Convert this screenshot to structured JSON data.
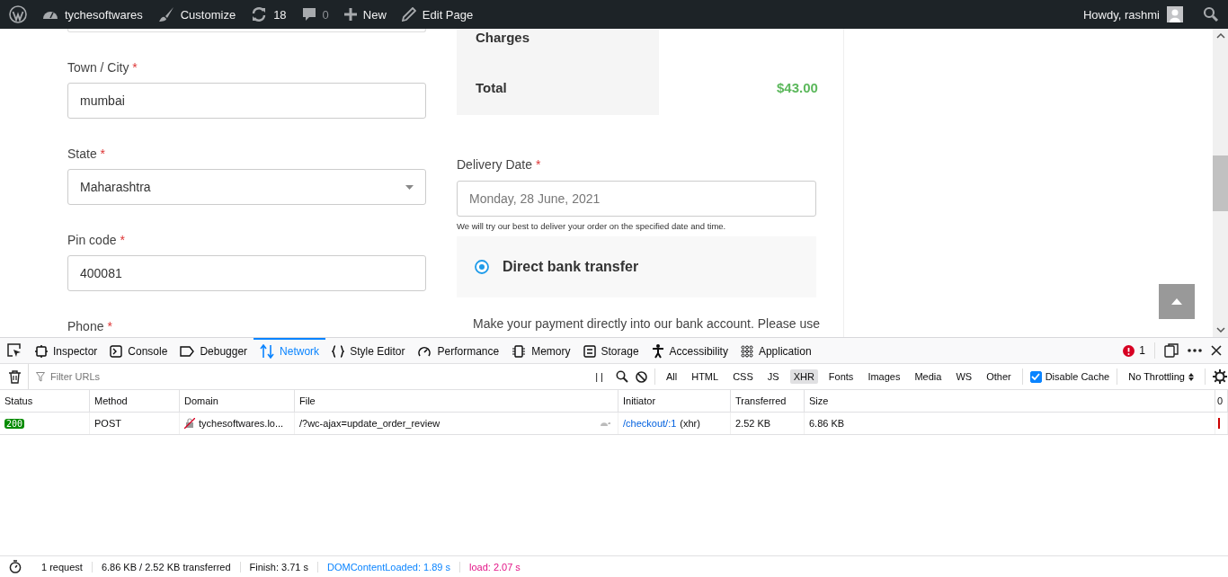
{
  "admin_bar": {
    "items": [
      {
        "kind": "wp-logo"
      },
      {
        "kind": "dashboard",
        "label": "tychesoftwares"
      },
      {
        "kind": "brush",
        "label": "Customize"
      },
      {
        "kind": "updates",
        "label": "18"
      },
      {
        "kind": "comments",
        "label": "0"
      },
      {
        "kind": "plus",
        "label": "New"
      },
      {
        "kind": "pencil",
        "label": "Edit Page"
      }
    ],
    "greeting": "Howdy, rashmi"
  },
  "billing_fields": [
    {
      "label": "Town / City",
      "required_mark": "*",
      "kind": "text",
      "value": "mumbai"
    },
    {
      "label": "State",
      "required_mark": "*",
      "kind": "select",
      "value": "Maharashtra"
    },
    {
      "label": "Pin code",
      "required_mark": "*",
      "kind": "text",
      "value": "400081"
    },
    {
      "label": "Phone",
      "required_mark": "*",
      "kind": "cut"
    }
  ],
  "order_summary": {
    "rows": [
      {
        "label": "Charges",
        "value": ""
      },
      {
        "label": "Total",
        "value": "$43.00"
      }
    ]
  },
  "delivery_date": {
    "label": "Delivery Date",
    "required_mark": "*",
    "placeholder": "Monday, 28 June, 2021",
    "hint": "We will try our best to deliver your order on the specified date and time."
  },
  "payment": {
    "method": "Direct bank transfer",
    "selected": true,
    "description": "Make your payment directly into our bank account. Please use"
  },
  "devtools": {
    "tabs": [
      {
        "kind": "inspector",
        "label": "Inspector",
        "selected": false
      },
      {
        "kind": "console",
        "label": "Console",
        "selected": false
      },
      {
        "kind": "debugger",
        "label": "Debugger",
        "selected": false
      },
      {
        "kind": "network",
        "label": "Network",
        "selected": true
      },
      {
        "kind": "style",
        "label": "Style Editor",
        "selected": false
      },
      {
        "kind": "performance",
        "label": "Performance",
        "selected": false
      },
      {
        "kind": "memory",
        "label": "Memory",
        "selected": false
      },
      {
        "kind": "storage",
        "label": "Storage",
        "selected": false
      },
      {
        "kind": "accessibility",
        "label": "Accessibility",
        "selected": false
      },
      {
        "kind": "application",
        "label": "Application",
        "selected": false
      }
    ],
    "error_count": "1",
    "filter_placeholder": "Filter URLs",
    "pause_label": "| |",
    "type_filters": [
      {
        "label": "All",
        "selected": false
      },
      {
        "label": "HTML",
        "selected": false
      },
      {
        "label": "CSS",
        "selected": false
      },
      {
        "label": "JS",
        "selected": false
      },
      {
        "label": "XHR",
        "selected": true
      },
      {
        "label": "Fonts",
        "selected": false
      },
      {
        "label": "Images",
        "selected": false
      },
      {
        "label": "Media",
        "selected": false
      },
      {
        "label": "WS",
        "selected": false
      },
      {
        "label": "Other",
        "selected": false
      }
    ],
    "disable_cache": {
      "label": "Disable Cache",
      "checked": true
    },
    "throttling": "No Throttling",
    "columns": [
      "Status",
      "Method",
      "Domain",
      "File",
      "Initiator",
      "Transferred",
      "Size",
      "0"
    ],
    "requests": [
      {
        "status": "200",
        "method": "POST",
        "domain": "tychesoftwares.lo...",
        "file": "/?wc-ajax=update_order_review",
        "initiator": "/checkout/:1",
        "initiator_type": "(xhr)",
        "transferred": "2.52 KB",
        "size": "6.86 KB"
      }
    ],
    "summary": [
      {
        "kind": "plain",
        "text": "1 request"
      },
      {
        "kind": "plain",
        "text": "6.86 KB / 2.52 KB transferred"
      },
      {
        "kind": "plain",
        "text": "Finish: 3.71 s"
      },
      {
        "kind": "dom",
        "text": "DOMContentLoaded: 1.89 s"
      },
      {
        "kind": "load",
        "text": "load: 2.07 s"
      }
    ]
  }
}
